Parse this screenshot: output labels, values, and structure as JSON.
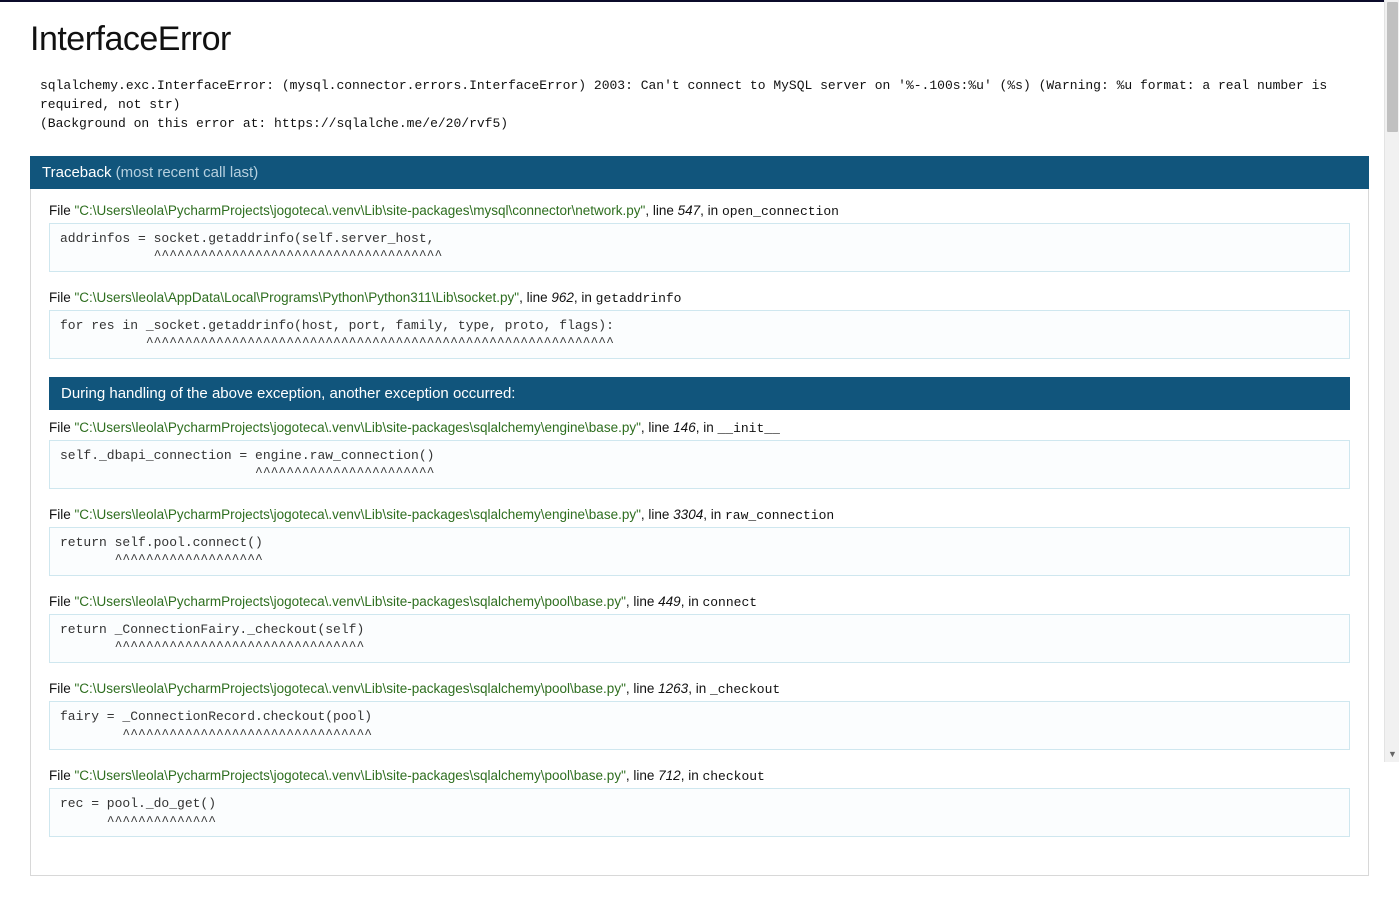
{
  "title": "InterfaceError",
  "error_message": "sqlalchemy.exc.InterfaceError: (mysql.connector.errors.InterfaceError) 2003: Can't connect to MySQL server on '%-.100s:%u' (%s) (Warning: %u format: a real number is required, not str)\n(Background on this error at: https://sqlalche.me/e/20/rvf5)",
  "traceback_header": {
    "title": "Traceback",
    "subtitle": "(most recent call last)"
  },
  "pre_frames": [
    {
      "path": "\"C:\\Users\\leola\\PycharmProjects\\jogoteca\\.venv\\Lib\\site-packages\\mysql\\connector\\network.py\"",
      "line": "547",
      "func": "open_connection",
      "code": "addrinfos = socket.getaddrinfo(self.server_host,\n            ^^^^^^^^^^^^^^^^^^^^^^^^^^^^^^^^^^^^^"
    },
    {
      "path": "\"C:\\Users\\leola\\AppData\\Local\\Programs\\Python\\Python311\\Lib\\socket.py\"",
      "line": "962",
      "func": "getaddrinfo",
      "code": "for res in _socket.getaddrinfo(host, port, family, type, proto, flags):\n           ^^^^^^^^^^^^^^^^^^^^^^^^^^^^^^^^^^^^^^^^^^^^^^^^^^^^^^^^^^^^"
    }
  ],
  "during_header": "During handling of the above exception, another exception occurred:",
  "post_frames": [
    {
      "path": "\"C:\\Users\\leola\\PycharmProjects\\jogoteca\\.venv\\Lib\\site-packages\\sqlalchemy\\engine\\base.py\"",
      "line": "146",
      "func": "__init__",
      "code": "self._dbapi_connection = engine.raw_connection()\n                         ^^^^^^^^^^^^^^^^^^^^^^^"
    },
    {
      "path": "\"C:\\Users\\leola\\PycharmProjects\\jogoteca\\.venv\\Lib\\site-packages\\sqlalchemy\\engine\\base.py\"",
      "line": "3304",
      "func": "raw_connection",
      "code": "return self.pool.connect()\n       ^^^^^^^^^^^^^^^^^^^"
    },
    {
      "path": "\"C:\\Users\\leola\\PycharmProjects\\jogoteca\\.venv\\Lib\\site-packages\\sqlalchemy\\pool\\base.py\"",
      "line": "449",
      "func": "connect",
      "code": "return _ConnectionFairy._checkout(self)\n       ^^^^^^^^^^^^^^^^^^^^^^^^^^^^^^^^"
    },
    {
      "path": "\"C:\\Users\\leola\\PycharmProjects\\jogoteca\\.venv\\Lib\\site-packages\\sqlalchemy\\pool\\base.py\"",
      "line": "1263",
      "func": "_checkout",
      "code": "fairy = _ConnectionRecord.checkout(pool)\n        ^^^^^^^^^^^^^^^^^^^^^^^^^^^^^^^^"
    },
    {
      "path": "\"C:\\Users\\leola\\PycharmProjects\\jogoteca\\.venv\\Lib\\site-packages\\sqlalchemy\\pool\\base.py\"",
      "line": "712",
      "func": "checkout",
      "code": "rec = pool._do_get()\n      ^^^^^^^^^^^^^^"
    }
  ],
  "labels": {
    "file": "File ",
    "line": ", line ",
    "in": ", in "
  }
}
